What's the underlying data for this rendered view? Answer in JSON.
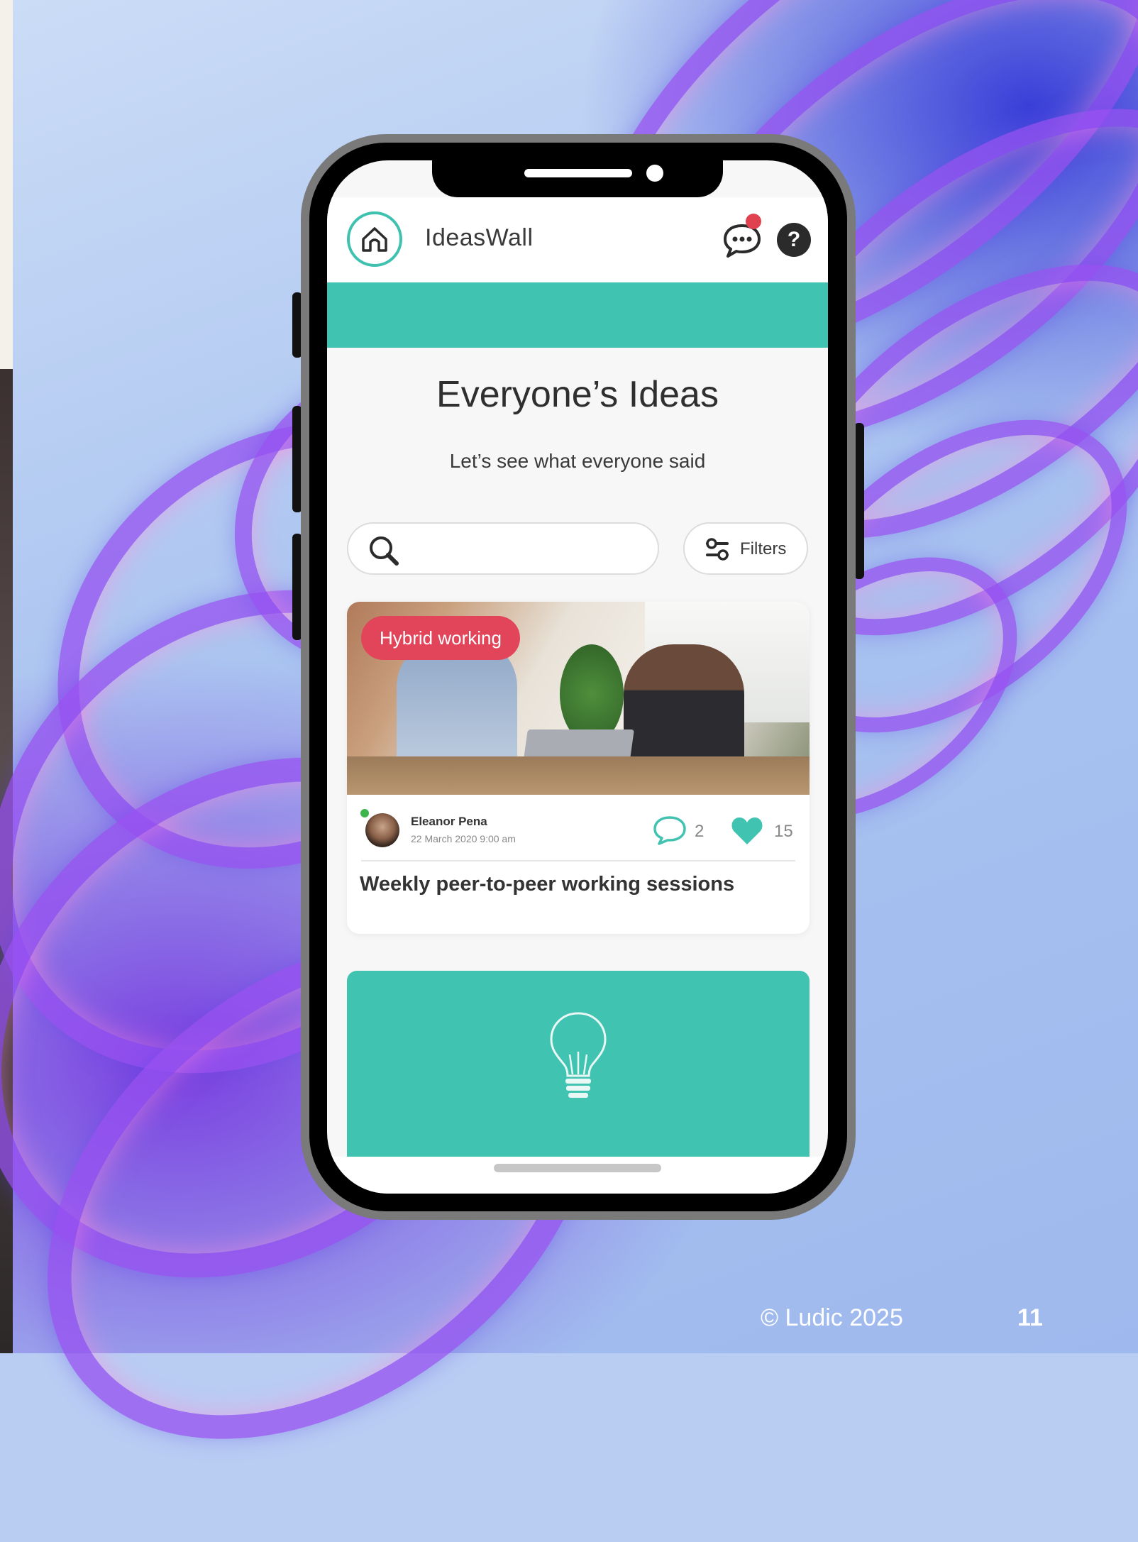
{
  "app": {
    "title": "IdeasWall",
    "help_label": "?"
  },
  "page": {
    "title": "Everyone’s Ideas",
    "subtitle": "Let’s see what everyone said"
  },
  "search": {
    "placeholder": ""
  },
  "filters": {
    "label": "Filters"
  },
  "ideas": [
    {
      "tag": "Hybrid working",
      "author": "Eleanor Pena",
      "date": "22 March 2020 9:00 am",
      "comments": "2",
      "likes": "15",
      "title": "Weekly peer-to-peer working sessions"
    }
  ],
  "slide": {
    "copyright": "© Ludic 2025",
    "page_number": "11"
  },
  "colors": {
    "teal": "#40c3b1",
    "tag_red": "#e2455a",
    "notification_red": "#e0414f",
    "online_green": "#3db54a"
  },
  "icons": [
    "home-icon",
    "chat-icon",
    "help-icon",
    "search-icon",
    "filters-icon",
    "comment-icon",
    "heart-icon",
    "lightbulb-icon"
  ]
}
